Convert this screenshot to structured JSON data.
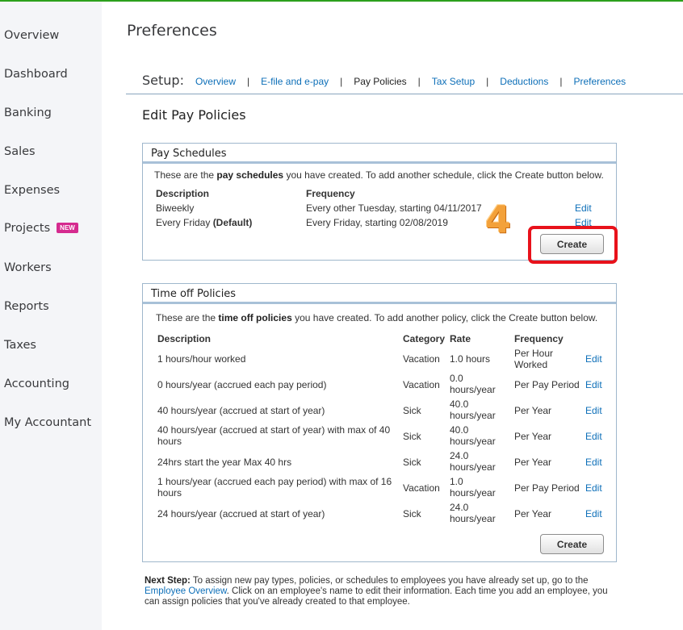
{
  "sidebar": {
    "items": [
      {
        "label": "Overview"
      },
      {
        "label": "Dashboard"
      },
      {
        "label": "Banking"
      },
      {
        "label": "Sales"
      },
      {
        "label": "Expenses"
      },
      {
        "label": "Projects",
        "badge": "NEW"
      },
      {
        "label": "Workers"
      },
      {
        "label": "Reports"
      },
      {
        "label": "Taxes"
      },
      {
        "label": "Accounting"
      },
      {
        "label": "My Accountant"
      }
    ]
  },
  "page": {
    "title": "Preferences"
  },
  "setup": {
    "label": "Setup:",
    "separator": "|",
    "links": [
      {
        "label": "Overview"
      },
      {
        "label": "E-file and e-pay"
      },
      {
        "label": "Pay Policies"
      },
      {
        "label": "Tax Setup"
      },
      {
        "label": "Deductions"
      },
      {
        "label": "Preferences"
      }
    ]
  },
  "section": {
    "title": "Edit Pay Policies"
  },
  "pay_schedules": {
    "title": "Pay Schedules",
    "intro_pre": "These are the ",
    "intro_bold": "pay schedules",
    "intro_post": " you have created. To add another schedule, click the Create button below.",
    "col_description": "Description",
    "col_frequency": "Frequency",
    "rows": [
      {
        "description": "Biweekly",
        "default_tag": "",
        "frequency": "Every other Tuesday, starting 04/11/2017",
        "edit": "Edit"
      },
      {
        "description": "Every Friday ",
        "default_tag": "(Default)",
        "frequency": "Every Friday, starting 02/08/2019",
        "edit": "Edit"
      }
    ],
    "create_label": "Create"
  },
  "annotation": {
    "step": "4",
    "color": "#e8121b"
  },
  "time_off": {
    "title": "Time off Policies",
    "intro_pre": "These are the ",
    "intro_bold": "time off policies",
    "intro_post": " you have created. To add another policy, click the Create button below.",
    "col_description": "Description",
    "col_category": "Category",
    "col_rate": "Rate",
    "col_frequency": "Frequency",
    "rows": [
      {
        "description": "1 hours/hour worked",
        "category": "Vacation",
        "rate": "1.0 hours",
        "frequency": "Per Hour Worked",
        "edit": "Edit"
      },
      {
        "description": "0 hours/year (accrued each pay period)",
        "category": "Vacation",
        "rate": "0.0 hours/year",
        "frequency": "Per Pay Period",
        "edit": "Edit"
      },
      {
        "description": "40 hours/year (accrued at start of year)",
        "category": "Sick",
        "rate": "40.0 hours/year",
        "frequency": "Per Year",
        "edit": "Edit"
      },
      {
        "description": "40 hours/year (accrued at start of year) with max of 40 hours",
        "category": "Sick",
        "rate": "40.0 hours/year",
        "frequency": "Per Year",
        "edit": "Edit"
      },
      {
        "description": "24hrs start the year Max 40 hrs",
        "category": "Sick",
        "rate": "24.0 hours/year",
        "frequency": "Per Year",
        "edit": "Edit"
      },
      {
        "description": "1 hours/year (accrued each pay period) with max of 16 hours",
        "category": "Vacation",
        "rate": "1.0 hours/year",
        "frequency": "Per Pay Period",
        "edit": "Edit"
      },
      {
        "description": "24 hours/year (accrued at start of year)",
        "category": "Sick",
        "rate": "24.0 hours/year",
        "frequency": "Per Year",
        "edit": "Edit"
      }
    ],
    "create_label": "Create"
  },
  "next_step": {
    "label": "Next Step:",
    "text_pre": " To assign new pay types, policies, or schedules to employees you have already set up, go to the ",
    "link": "Employee Overview",
    "text_post": ". Click on an employee's name to edit their information. Each time you add an employee, you can assign policies that you've already created to that employee."
  },
  "colors": {
    "accent_green": "#2ca01c",
    "link_blue": "#0d6fb8",
    "badge_pink": "#d52b8f",
    "panel_border": "#9fb7cc"
  }
}
